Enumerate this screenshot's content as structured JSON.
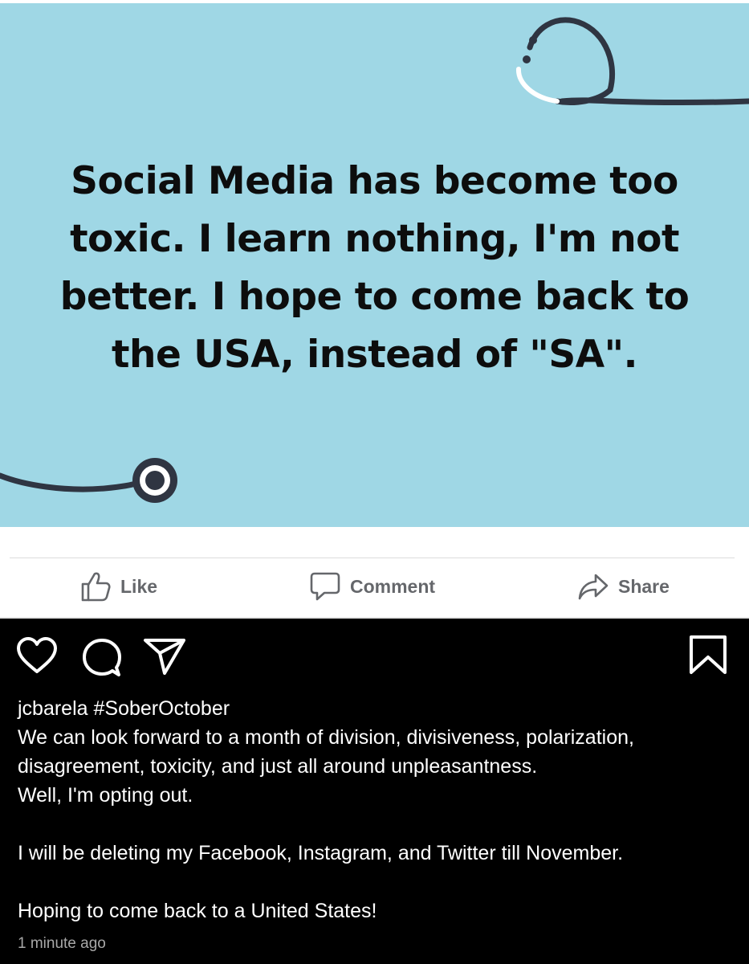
{
  "post": {
    "image_text": "Social Media has become too toxic. I learn nothing, I'm not better. I hope to come back to the USA, instead of \"SA\".",
    "background_color": "#9fd7e5",
    "decoration_icon": "stethoscope-icon"
  },
  "actions": {
    "like": {
      "label": "Like",
      "icon": "thumbs-up-icon"
    },
    "comment": {
      "label": "Comment",
      "icon": "comment-icon"
    },
    "share": {
      "label": "Share",
      "icon": "share-arrow-icon"
    }
  },
  "instagram": {
    "icons": [
      "heart-icon",
      "comment-bubble-icon",
      "send-icon",
      "bookmark-icon"
    ],
    "username": "jcbarela",
    "hashtag": "#SoberOctober",
    "caption_lines": [
      "We can look forward to a month of division, divisiveness, polarization,",
      "disagreement, toxicity, and just all around unpleasantness.",
      "Well, I'm opting out.",
      "",
      "I will be deleting my Facebook, Instagram, and Twitter till November.",
      "",
      "Hoping to come back to a United States!"
    ],
    "timestamp": "1 minute ago"
  }
}
